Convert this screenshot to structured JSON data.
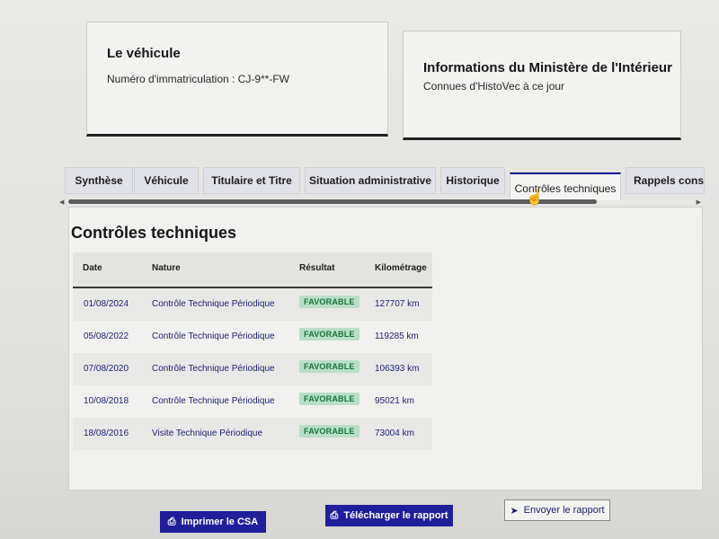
{
  "vehicle_card": {
    "title": "Le véhicule",
    "registration": "Numéro d'immatriculation : CJ-9**-FW"
  },
  "ministry_card": {
    "title": "Informations du Ministère de l'Intérieur",
    "subtitle": "Connues d'HistoVec à ce jour"
  },
  "tabs": [
    {
      "label": "Synthèse"
    },
    {
      "label": "Véhicule"
    },
    {
      "label": "Titulaire et Titre"
    },
    {
      "label": "Situation administrative"
    },
    {
      "label": "Historique"
    },
    {
      "label": "Contrôles techniques"
    },
    {
      "label": "Rappels constru"
    }
  ],
  "active_tab": "Contrôles techniques",
  "panel": {
    "title": "Contrôles techniques",
    "headers": {
      "date": "Date",
      "nature": "Nature",
      "result": "Résultat",
      "mileage": "Kilométrage"
    },
    "rows": [
      {
        "date": "01/08/2024",
        "nature": "Contrôle Technique Périodique",
        "result": "FAVORABLE",
        "mileage": "127707 km"
      },
      {
        "date": "05/08/2022",
        "nature": "Contrôle Technique Périodique",
        "result": "FAVORABLE",
        "mileage": "119285 km"
      },
      {
        "date": "07/08/2020",
        "nature": "Contrôle Technique Périodique",
        "result": "FAVORABLE",
        "mileage": "106393 km"
      },
      {
        "date": "10/08/2018",
        "nature": "Contrôle Technique Périodique",
        "result": "FAVORABLE",
        "mileage": "95021 km"
      },
      {
        "date": "18/08/2016",
        "nature": "Visite Technique Périodique",
        "result": "FAVORABLE",
        "mileage": "73004 km"
      }
    ]
  },
  "actions": {
    "print_csa": "Imprimer le CSA",
    "download_report": "Télécharger le rapport",
    "send_report": "Envoyer le rapport"
  },
  "icons": {
    "printer": "printer-icon",
    "send": "paper-plane-icon",
    "cursor": "hand-pointer-icon"
  },
  "colors": {
    "primary": "#1f1f9c",
    "success_bg": "#b8dec8",
    "success_text": "#18753c",
    "tab_active_border": "#000091"
  }
}
